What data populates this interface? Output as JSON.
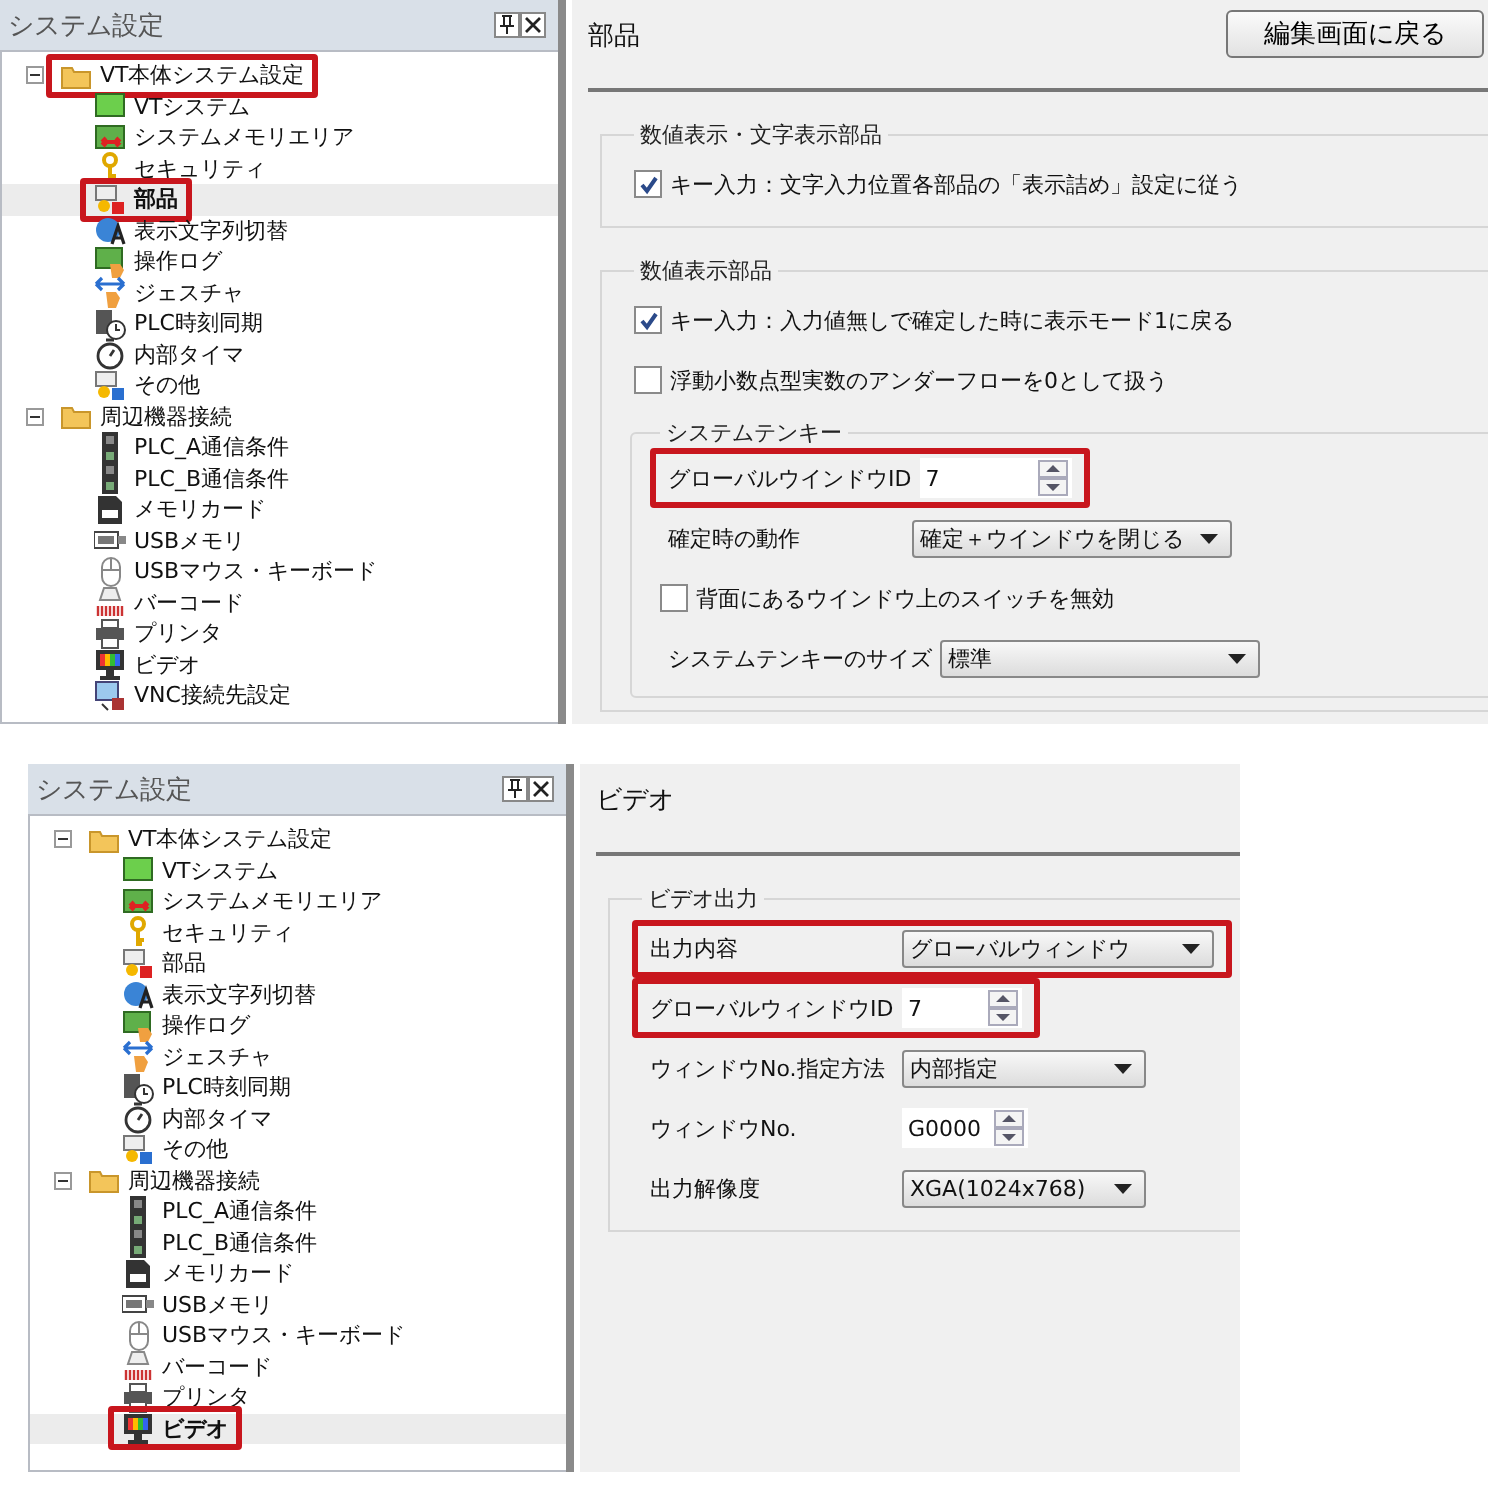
{
  "screens": [
    {
      "sidebar": {
        "title": "システム設定",
        "tree": [
          {
            "label": "VT本体システム設定",
            "expanded": true,
            "selected": false,
            "highlighted": true,
            "children": [
              {
                "label": "VTシステム",
                "selected": false,
                "highlighted": false
              },
              {
                "label": "システムメモリエリア",
                "selected": false,
                "highlighted": false
              },
              {
                "label": "セキュリティ",
                "selected": false,
                "highlighted": false
              },
              {
                "label": "部品",
                "selected": true,
                "highlighted": true
              },
              {
                "label": "表示文字列切替",
                "selected": false,
                "highlighted": false
              },
              {
                "label": "操作ログ",
                "selected": false,
                "highlighted": false
              },
              {
                "label": "ジェスチャ",
                "selected": false,
                "highlighted": false
              },
              {
                "label": "PLC時刻同期",
                "selected": false,
                "highlighted": false
              },
              {
                "label": "内部タイマ",
                "selected": false,
                "highlighted": false
              },
              {
                "label": "その他",
                "selected": false,
                "highlighted": false
              }
            ]
          },
          {
            "label": "周辺機器接続",
            "expanded": true,
            "selected": false,
            "highlighted": false,
            "children": [
              {
                "label": "PLC_A通信条件",
                "selected": false,
                "highlighted": false
              },
              {
                "label": "PLC_B通信条件",
                "selected": false,
                "highlighted": false
              },
              {
                "label": "メモリカード",
                "selected": false,
                "highlighted": false
              },
              {
                "label": "USBメモリ",
                "selected": false,
                "highlighted": false
              },
              {
                "label": "USBマウス・キーボード",
                "selected": false,
                "highlighted": false
              },
              {
                "label": "バーコード",
                "selected": false,
                "highlighted": false
              },
              {
                "label": "プリンタ",
                "selected": false,
                "highlighted": false
              },
              {
                "label": "ビデオ",
                "selected": false,
                "highlighted": false
              },
              {
                "label": "VNC接続先設定",
                "selected": false,
                "highlighted": false
              }
            ]
          }
        ]
      },
      "panel": {
        "title": "部品",
        "button": "編集画面に戻る",
        "groups": [
          {
            "legend": "数値表示・文字表示部品",
            "controls": [
              {
                "kind": "checkbox",
                "label": "キー入力：文字入力位置各部品の「表示詰め」設定に従う",
                "checked": true
              }
            ]
          },
          {
            "legend": "数値表示部品",
            "controls": [
              {
                "kind": "checkbox",
                "label": "キー入力：入力値無しで確定した時に表示モード1に戻る",
                "checked": true
              },
              {
                "kind": "checkbox",
                "label": "浮動小数点型実数のアンダーフローを0として扱う",
                "checked": false
              },
              {
                "kind": "group",
                "legend": "システムテンキー",
                "controls": [
                  {
                    "kind": "spinner",
                    "label": "グローバルウインドウID",
                    "value": "7",
                    "highlighted": true
                  },
                  {
                    "kind": "dropdown",
                    "label": "確定時の動作",
                    "value": "確定＋ウインドウを閉じる",
                    "highlighted": false
                  },
                  {
                    "kind": "checkbox",
                    "label": "背面にあるウインドウ上のスイッチを無効",
                    "checked": false
                  },
                  {
                    "kind": "dropdown",
                    "label": "システムテンキーのサイズ",
                    "value": "標準",
                    "highlighted": false
                  }
                ]
              }
            ]
          }
        ]
      }
    },
    {
      "sidebar": {
        "title": "システム設定",
        "tree": [
          {
            "label": "VT本体システム設定",
            "expanded": true,
            "selected": false,
            "highlighted": false,
            "children": [
              {
                "label": "VTシステム",
                "selected": false,
                "highlighted": false
              },
              {
                "label": "システムメモリエリア",
                "selected": false,
                "highlighted": false
              },
              {
                "label": "セキュリティ",
                "selected": false,
                "highlighted": false
              },
              {
                "label": "部品",
                "selected": false,
                "highlighted": false
              },
              {
                "label": "表示文字列切替",
                "selected": false,
                "highlighted": false
              },
              {
                "label": "操作ログ",
                "selected": false,
                "highlighted": false
              },
              {
                "label": "ジェスチャ",
                "selected": false,
                "highlighted": false
              },
              {
                "label": "PLC時刻同期",
                "selected": false,
                "highlighted": false
              },
              {
                "label": "内部タイマ",
                "selected": false,
                "highlighted": false
              },
              {
                "label": "その他",
                "selected": false,
                "highlighted": false
              }
            ]
          },
          {
            "label": "周辺機器接続",
            "expanded": true,
            "selected": false,
            "highlighted": false,
            "children": [
              {
                "label": "PLC_A通信条件",
                "selected": false,
                "highlighted": false
              },
              {
                "label": "PLC_B通信条件",
                "selected": false,
                "highlighted": false
              },
              {
                "label": "メモリカード",
                "selected": false,
                "highlighted": false
              },
              {
                "label": "USBメモリ",
                "selected": false,
                "highlighted": false
              },
              {
                "label": "USBマウス・キーボード",
                "selected": false,
                "highlighted": false
              },
              {
                "label": "バーコード",
                "selected": false,
                "highlighted": false
              },
              {
                "label": "プリンタ",
                "selected": false,
                "highlighted": false
              },
              {
                "label": "ビデオ",
                "selected": true,
                "highlighted": true
              }
            ]
          }
        ]
      },
      "panel": {
        "title": "ビデオ",
        "groups": [
          {
            "legend": "ビデオ出力",
            "controls": [
              {
                "kind": "dropdown",
                "label": "出力内容",
                "value": "グローバルウィンドウ",
                "highlighted": true
              },
              {
                "kind": "spinner",
                "label": "グローバルウィンドウID",
                "value": "7",
                "highlighted": true
              },
              {
                "kind": "dropdown",
                "label": "ウィンドウNo.指定方法",
                "value": "内部指定",
                "highlighted": false
              },
              {
                "kind": "spinner",
                "label": "ウィンドウNo.",
                "value": "G0000",
                "highlighted": false
              },
              {
                "kind": "dropdown",
                "label": "出力解像度",
                "value": "XGA(1024x768)",
                "highlighted": false
              }
            ]
          }
        ]
      }
    }
  ]
}
